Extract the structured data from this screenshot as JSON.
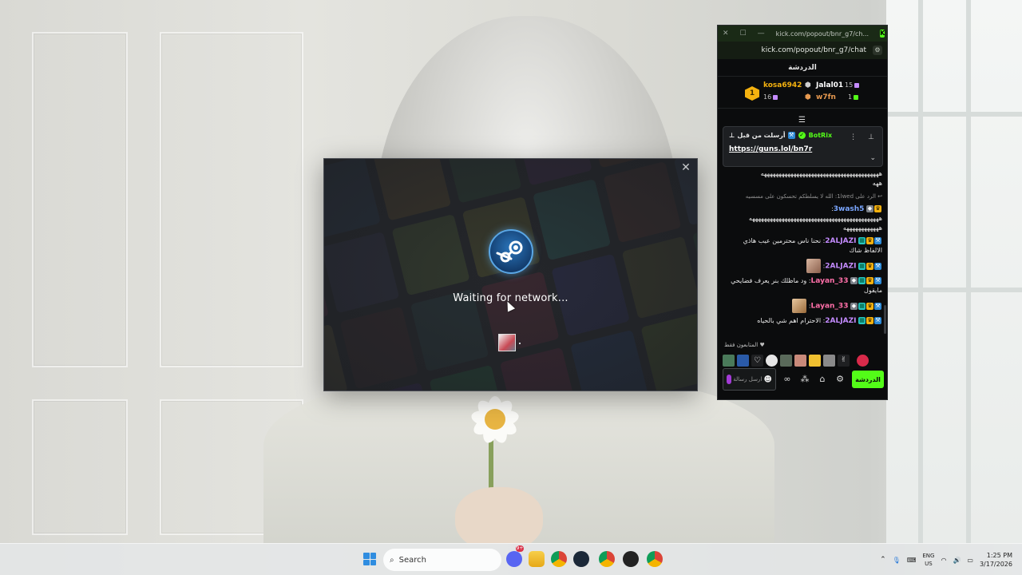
{
  "steam": {
    "status_text": "Waiting for network...",
    "close_glyph": "✕"
  },
  "kick": {
    "titlebar": {
      "close_glyph": "✕",
      "maximize_glyph": "☐",
      "minimize_glyph": "—",
      "url_short": "kick.com/popout/bnr_g7/ch...",
      "logo_letter": "K"
    },
    "urlbar": {
      "url": "kick.com/popout/bnr_g7/chat"
    },
    "header_title": "الدردشة",
    "leaderboard": {
      "rank": "1",
      "first": {
        "name": "kosa6942",
        "count": "16"
      },
      "second": {
        "name": "Jalal01",
        "count": "15"
      },
      "third": {
        "name": "w7fn",
        "count": "1"
      }
    },
    "pinned": {
      "pinned_by_label": "أرسلت من قبل",
      "author": "BotRix",
      "link": "https://guns.lol/bn7r",
      "menu_glyph": "⋮",
      "pin_glyph": "📌",
      "expand_glyph": "⌄"
    },
    "chat": [
      {
        "type": "text",
        "text": "ههههههههههههههههههههههههههههههههههههههههه\nههه"
      },
      {
        "type": "reply",
        "text": "الرد على 1lwed: الله لا يسلطكم تحسكون على مسسيه"
      },
      {
        "type": "msg",
        "user": "3wash5",
        "user_color": "#7aa6ff",
        "text": "ههههههههههههههههههههههههههههههههههههههههههههه\nههههههههههههه"
      },
      {
        "type": "msg",
        "user": "2ALJAZI",
        "user_color": "#c48bff",
        "text": "نحنا ناس محترمين عيب هاذي الالفاظ شاك"
      },
      {
        "type": "msg",
        "user": "2ALJAZI",
        "user_color": "#c48bff",
        "text": "",
        "emote": true
      },
      {
        "type": "msg",
        "user": "Layan_33",
        "user_color": "#ff6fa8",
        "text": "ود ماظلك بنر يعرف فضايحي مايقول"
      },
      {
        "type": "msg",
        "user": "Layan_33",
        "user_color": "#ff6fa8",
        "text": "",
        "emote": true
      },
      {
        "type": "msg",
        "user": "2ALJAZI",
        "user_color": "#c48bff",
        "text": "الاحترام اهم شي بالحياه"
      }
    ],
    "supporters_label": "المتابعون فقط",
    "input_placeholder": "ارسل رسالة",
    "send_label": "الدردشة"
  },
  "taskbar": {
    "search_placeholder": "Search",
    "discord_badge": "9+",
    "lang_top": "ENG",
    "lang_bottom": "US",
    "time": "1:25 PM",
    "date": "3/17/2026"
  },
  "colors": {
    "kick_green": "#53fc18",
    "steam_blue": "#2a75bb"
  }
}
